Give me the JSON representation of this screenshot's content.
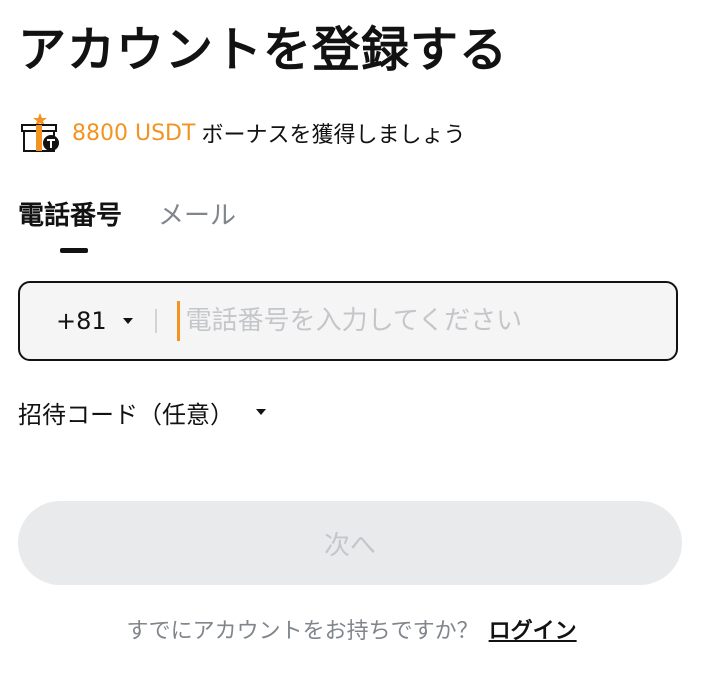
{
  "header": {
    "title": "アカウントを登録する"
  },
  "bonus": {
    "icon": "gift-usdt-icon",
    "amount": "8800 USDT",
    "text": "ボーナスを獲得しましょう",
    "accent_color": "#f39321"
  },
  "tabs": [
    {
      "label": "電話番号",
      "active": true
    },
    {
      "label": "メール",
      "active": false
    }
  ],
  "phone": {
    "country_code": "+81",
    "placeholder": "電話番号を入力してください",
    "value": ""
  },
  "referral": {
    "label": "招待コード（任意）"
  },
  "next_button": {
    "label": "次へ",
    "enabled": false
  },
  "login": {
    "question": "すでにアカウントをお持ちですか？",
    "link_label": "ログイン"
  }
}
